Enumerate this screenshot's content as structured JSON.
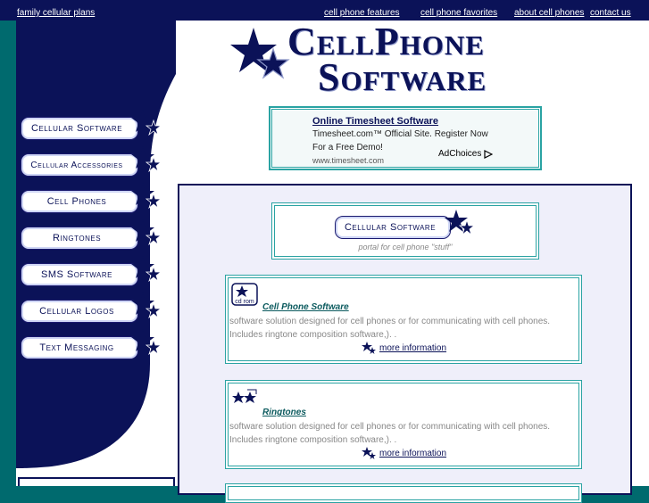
{
  "top_nav": {
    "left_link": "family cellular plans",
    "right_links": [
      "cell phone features",
      "cell phone favorites",
      "about cell phones",
      "contact us"
    ]
  },
  "logo": {
    "line1": "CellPhone",
    "line2": "Software",
    "icon": "double-star-icon"
  },
  "sidebar": {
    "items": [
      {
        "label": "Cellular Software"
      },
      {
        "label": "Cellular Accessories"
      },
      {
        "label": "Cell Phones"
      },
      {
        "label": "Ringtones"
      },
      {
        "label": "SMS Software"
      },
      {
        "label": "Cellular Logos"
      },
      {
        "label": "Text Messaging"
      }
    ]
  },
  "ad": {
    "title": "Online Timesheet Software",
    "line1": "Timesheet.com™ Official Site. Register Now",
    "line2": "For a Free Demo!",
    "url": "www.timesheet.com",
    "adchoices": "AdChoices"
  },
  "portal": {
    "button_label": "Cellular Software",
    "tagline": "portal for cell phone \"stuff\""
  },
  "cards": [
    {
      "icon": "cd-rom-icon",
      "icon_text": "cd rom",
      "title": "Cell Phone Software",
      "desc_line1": "software solution designed for cell phones or for communicating with cell phones.",
      "desc_line2": "Includes ringtone composition software,). .",
      "more": "more information"
    },
    {
      "icon": "stars-icon",
      "title": "Ringtones",
      "desc_line1": "software solution designed for cell phones or for communicating with cell phones.",
      "desc_line2": "Includes ringtone composition software,). .",
      "more": "more information"
    }
  ],
  "colors": {
    "navy": "#0b1258",
    "teal_bg": "#006a6e",
    "teal_border": "#2aa3a3",
    "panel_bg": "#efeffa"
  }
}
